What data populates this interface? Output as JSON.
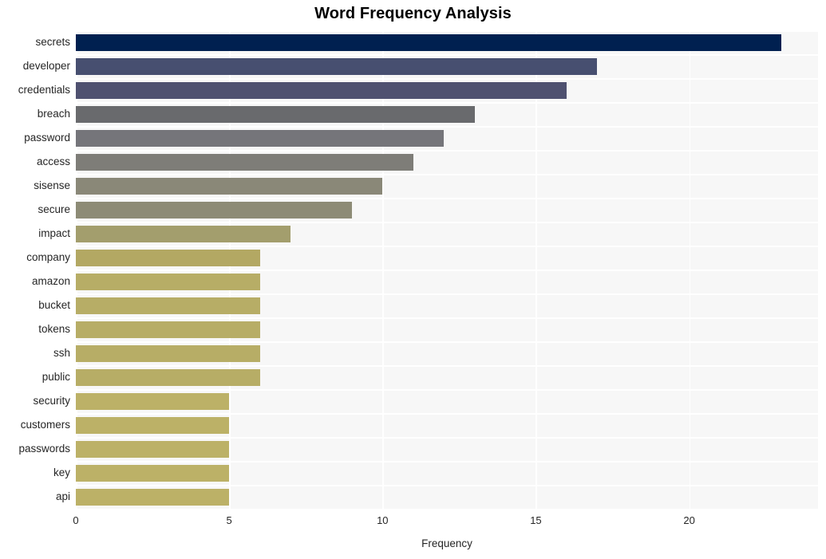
{
  "chart_data": {
    "type": "bar",
    "orientation": "horizontal",
    "title": "Word Frequency Analysis",
    "xlabel": "Frequency",
    "ylabel": "",
    "xlim": [
      0,
      24.2
    ],
    "ylim": [
      0,
      20
    ],
    "grid": true,
    "legend": null,
    "xticks": [
      "0",
      "5",
      "10",
      "15",
      "20"
    ],
    "xtick_values": [
      0,
      5,
      10,
      15,
      20
    ],
    "categories": [
      "secrets",
      "developer",
      "credentials",
      "breach",
      "password",
      "access",
      "sisense",
      "secure",
      "impact",
      "company",
      "amazon",
      "bucket",
      "tokens",
      "ssh",
      "public",
      "security",
      "customers",
      "passwords",
      "key",
      "api"
    ],
    "values": [
      23,
      17,
      16,
      13,
      12,
      11,
      10,
      9,
      7,
      6,
      6,
      6,
      6,
      6,
      6,
      5,
      5,
      5,
      5,
      5
    ],
    "bar_colors": [
      "#002050",
      "#474f70",
      "#4f5170",
      "#696a6d",
      "#75757a",
      "#7e7d78",
      "#8a8878",
      "#8d8b76",
      "#a39e6d",
      "#b3a863",
      "#b7ad66",
      "#b7ad66",
      "#b7ad66",
      "#b7ad66",
      "#b7ad66",
      "#bcb167",
      "#bcb167",
      "#bcb167",
      "#bcb167",
      "#bcb167"
    ],
    "plot_background": "#f7f7f7",
    "grid_color": "#ffffff",
    "figure_background": "#ffffff",
    "title_color": "#000000",
    "tick_label_color": "#262626"
  }
}
